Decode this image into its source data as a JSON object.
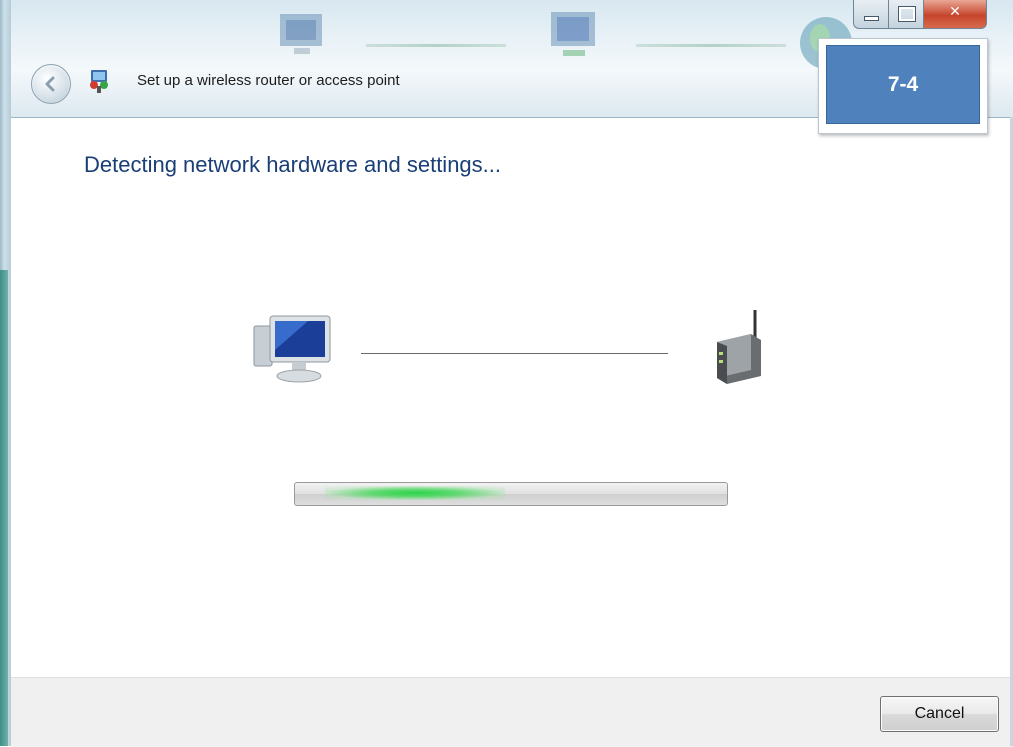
{
  "window": {
    "title": "Set up a wireless router or access point"
  },
  "badge": {
    "label": "7-4",
    "color": "#4f81bd"
  },
  "main": {
    "heading": "Detecting network hardware and settings...",
    "left_icon": "computer-icon",
    "right_icon": "wireless-router-icon",
    "progress_state": "indeterminate"
  },
  "footer": {
    "cancel_label": "Cancel"
  },
  "colors": {
    "heading": "#1a3f76",
    "progress": "#2ad449",
    "close": "#c6452c"
  }
}
